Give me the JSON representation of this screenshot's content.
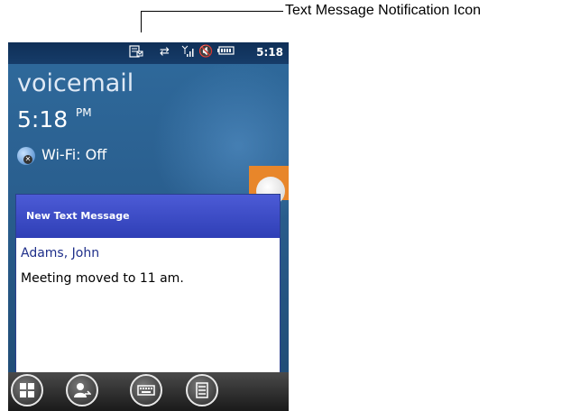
{
  "callout": {
    "label": "Text Message Notification Icon"
  },
  "status_bar": {
    "time": "5:18",
    "icons": [
      "text-message-icon",
      "data-sync-icon",
      "signal-icon",
      "volume-muted-icon",
      "battery-icon"
    ]
  },
  "today": {
    "title": "voicemail",
    "time": "5:18",
    "ampm": "PM",
    "wifi": "Wi-Fi: Off"
  },
  "notification": {
    "title": "New Text Message",
    "sender": "Adams, John",
    "message": "Meeting moved to 11 am."
  },
  "taskbar": {
    "buttons": [
      "start-icon",
      "contacts-icon",
      "keyboard-icon",
      "menu-icon"
    ]
  }
}
